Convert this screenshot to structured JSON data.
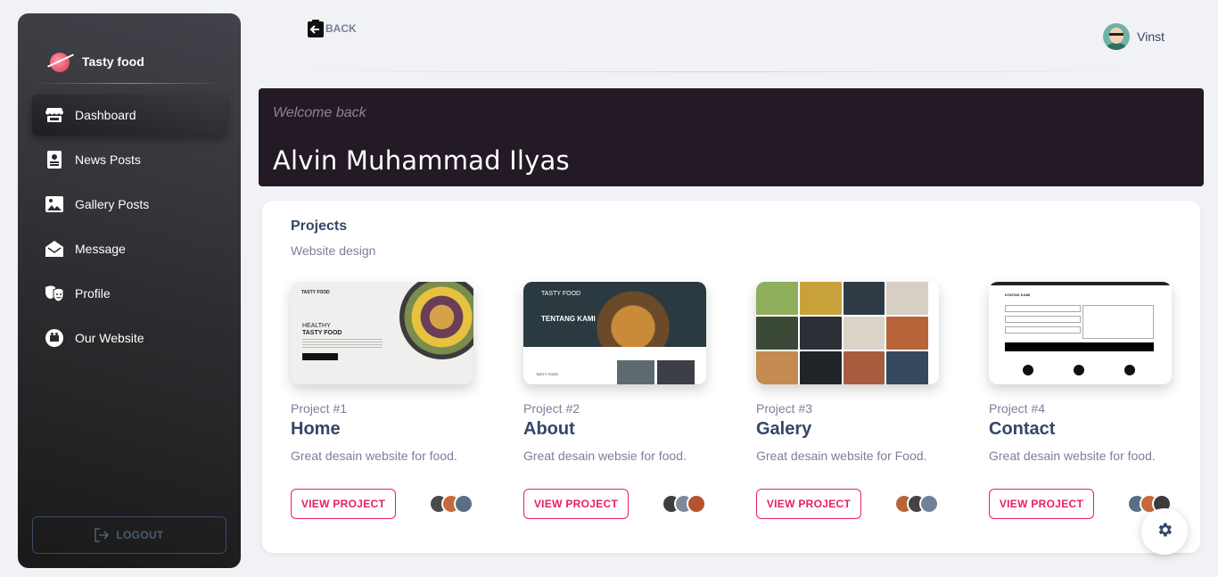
{
  "brand": {
    "name": "Tasty food"
  },
  "sidebar": {
    "items": [
      {
        "label": "Dashboard",
        "icon": "store-icon"
      },
      {
        "label": "News Posts",
        "icon": "contact-card-icon"
      },
      {
        "label": "Gallery Posts",
        "icon": "image-icon"
      },
      {
        "label": "Message",
        "icon": "envelope-open-icon"
      },
      {
        "label": "Profile",
        "icon": "masks-icon"
      },
      {
        "label": "Our Website",
        "icon": "web-icon"
      }
    ],
    "logout_label": "LOGOUT"
  },
  "topbar": {
    "back_label": "BACK",
    "user_name": "Vinst"
  },
  "welcome": {
    "subtitle": "Welcome back",
    "name": "Alvin Muhammad Ilyas"
  },
  "projects": {
    "title": "Projects",
    "subtitle": "Website design",
    "button_label": "VIEW PROJECT",
    "items": [
      {
        "number": "Project #1",
        "name": "Home",
        "description": "Great desain website for food.",
        "thumb_brand": "TASTY FOOD",
        "thumb_line1": "HEALTHY",
        "thumb_line2": "TASTY FOOD"
      },
      {
        "number": "Project #2",
        "name": "About",
        "description": "Great desain websie for food.",
        "thumb_brand": "TASTY FOOD",
        "thumb_heading": "TENTANG KAMI",
        "thumb_footer": "TASTY FOOD"
      },
      {
        "number": "Project #3",
        "name": "Galery",
        "description": "Great desain website for Food."
      },
      {
        "number": "Project #4",
        "name": "Contact",
        "description": "Great desain website for food.",
        "thumb_heading": "KONTAK KAMI"
      }
    ]
  },
  "colors": {
    "accent": "#e91e63",
    "banner": "#231a25",
    "sidebar_top": "#42424a",
    "sidebar_bottom": "#191919"
  }
}
